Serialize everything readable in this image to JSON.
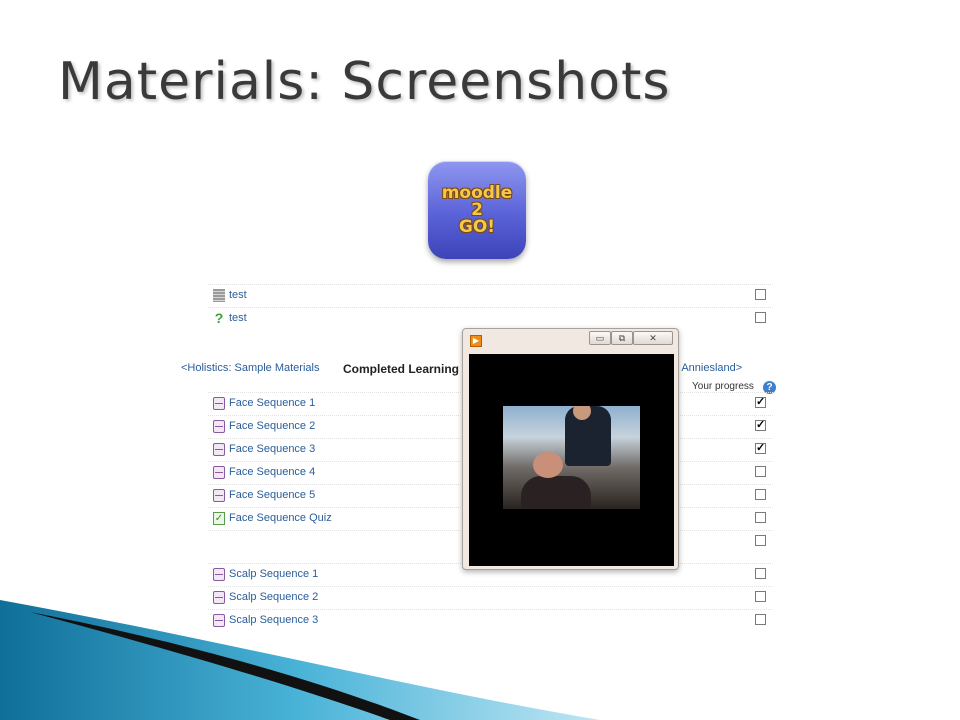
{
  "slide": {
    "title": "Materials: Screenshots"
  },
  "logo": {
    "text": "moodle\n2\nGO!"
  },
  "top_rows": [
    {
      "label": "test",
      "icon": "page-icon",
      "checked": false
    },
    {
      "label": "test",
      "icon": "question-icon",
      "checked": false
    }
  ],
  "nav": {
    "prev": "<Holistics: Sample Materials",
    "current": "Completed Learning",
    "next": "ial for Anniesland>"
  },
  "progress": {
    "label": "Your progress",
    "help": "?"
  },
  "face_rows": [
    {
      "label": "Face Sequence 1",
      "icon": "video-icon",
      "checked": true
    },
    {
      "label": "Face Sequence 2",
      "icon": "video-icon",
      "checked": true
    },
    {
      "label": "Face Sequence 3",
      "icon": "video-icon",
      "checked": true
    },
    {
      "label": "Face Sequence 4",
      "icon": "video-icon",
      "checked": false
    },
    {
      "label": "Face Sequence 5",
      "icon": "video-icon",
      "checked": false
    },
    {
      "label": "Face Sequence Quiz",
      "icon": "quiz-icon",
      "checked": false
    },
    {
      "label": "",
      "icon": "",
      "checked": false
    }
  ],
  "scalp_rows": [
    {
      "label": "Scalp Sequence 1",
      "icon": "video-icon",
      "checked": false
    },
    {
      "label": "Scalp Sequence 2",
      "icon": "video-icon",
      "checked": false
    },
    {
      "label": "Scalp Sequence 3",
      "icon": "video-icon",
      "checked": false
    }
  ],
  "player": {
    "buttons": {
      "minimize": "▭",
      "restore": "⧉",
      "close": "✕"
    },
    "app_icon": "play-icon"
  },
  "colors": {
    "title": "#3a3a3a",
    "link": "#2a5d9a",
    "accent": "#1e8ab4"
  }
}
